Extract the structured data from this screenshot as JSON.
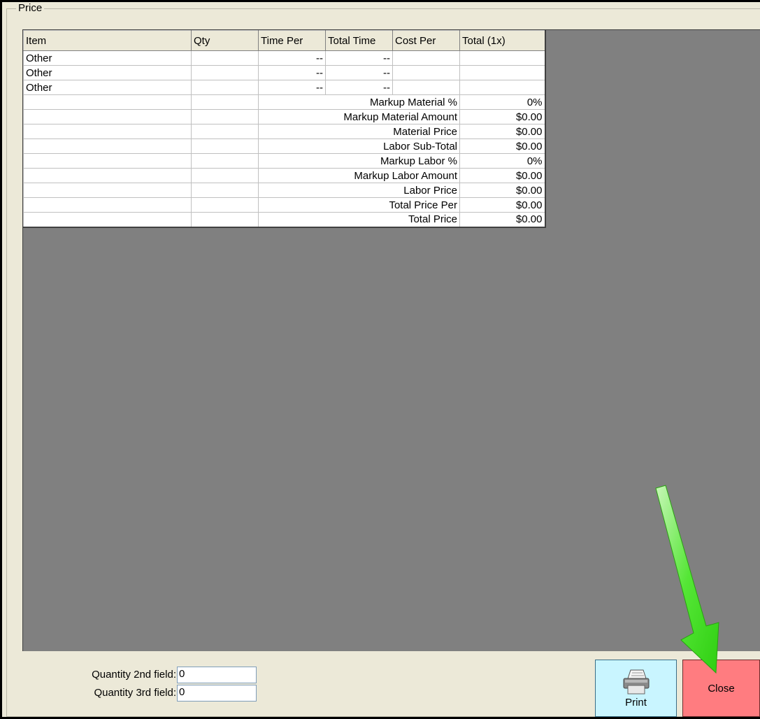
{
  "group": {
    "legend": "Price"
  },
  "table": {
    "columns": [
      "Item",
      "Qty",
      "Time Per",
      "Total Time",
      "Cost Per",
      "Total (1x)"
    ],
    "items": [
      {
        "item": "Other",
        "qty": "",
        "time_per": "--",
        "total_time": "--",
        "cost_per": "",
        "total": ""
      },
      {
        "item": "Other",
        "qty": "",
        "time_per": "--",
        "total_time": "--",
        "cost_per": "",
        "total": ""
      },
      {
        "item": "Other",
        "qty": "",
        "time_per": "--",
        "total_time": "--",
        "cost_per": "",
        "total": ""
      }
    ],
    "summary": [
      {
        "label": "Markup Material %",
        "value": "0%"
      },
      {
        "label": "Markup Material Amount",
        "value": "$0.00"
      },
      {
        "label": "Material Price",
        "value": "$0.00"
      },
      {
        "label": "Labor Sub-Total",
        "value": "$0.00"
      },
      {
        "label": "Markup Labor %",
        "value": "0%"
      },
      {
        "label": "Markup Labor Amount",
        "value": "$0.00"
      },
      {
        "label": "Labor Price",
        "value": "$0.00"
      },
      {
        "label": "Total Price Per",
        "value": "$0.00"
      },
      {
        "label": "Total Price",
        "value": "$0.00"
      }
    ]
  },
  "quantities": {
    "second": {
      "label": "Quantity 2nd field:",
      "value": "0"
    },
    "third": {
      "label": "Quantity 3rd field:",
      "value": "0"
    }
  },
  "buttons": {
    "print": {
      "label": "Print",
      "icon": "printer-icon",
      "color": "#c9f5ff"
    },
    "close": {
      "label": "Close",
      "color": "#ff7c80"
    }
  },
  "annotation": {
    "arrow_color": "#3ddc1a"
  }
}
